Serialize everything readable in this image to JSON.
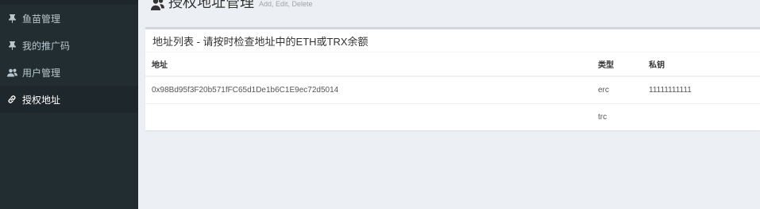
{
  "sidebar": {
    "items": [
      {
        "label": "鱼苗管理",
        "icon": "pin-icon",
        "active": false
      },
      {
        "label": "我的推广码",
        "icon": "pin-icon",
        "active": false
      },
      {
        "label": "用户管理",
        "icon": "users-icon",
        "active": false
      },
      {
        "label": "授权地址",
        "icon": "link-icon",
        "active": true
      }
    ]
  },
  "header": {
    "icon": "users-icon",
    "title": "授权地址管理",
    "subtitle": "Add, Edit, Delete"
  },
  "box": {
    "title": "地址列表 - 请按时检查地址中的ETH或TRX余额",
    "columns": [
      "地址",
      "类型",
      "私钥"
    ],
    "rows": [
      {
        "address": "0x98Bd95f3F20b571fFC65d1De1b6C1E9ec72d5014",
        "type": "erc",
        "key": "11111111111"
      },
      {
        "address": "",
        "type": "trc",
        "key": ""
      }
    ]
  },
  "colors": {
    "sidebar_bg": "#222d32",
    "sidebar_active_bg": "#1e282c",
    "content_bg": "#ecf0f5",
    "box_border": "#d2d6de"
  }
}
